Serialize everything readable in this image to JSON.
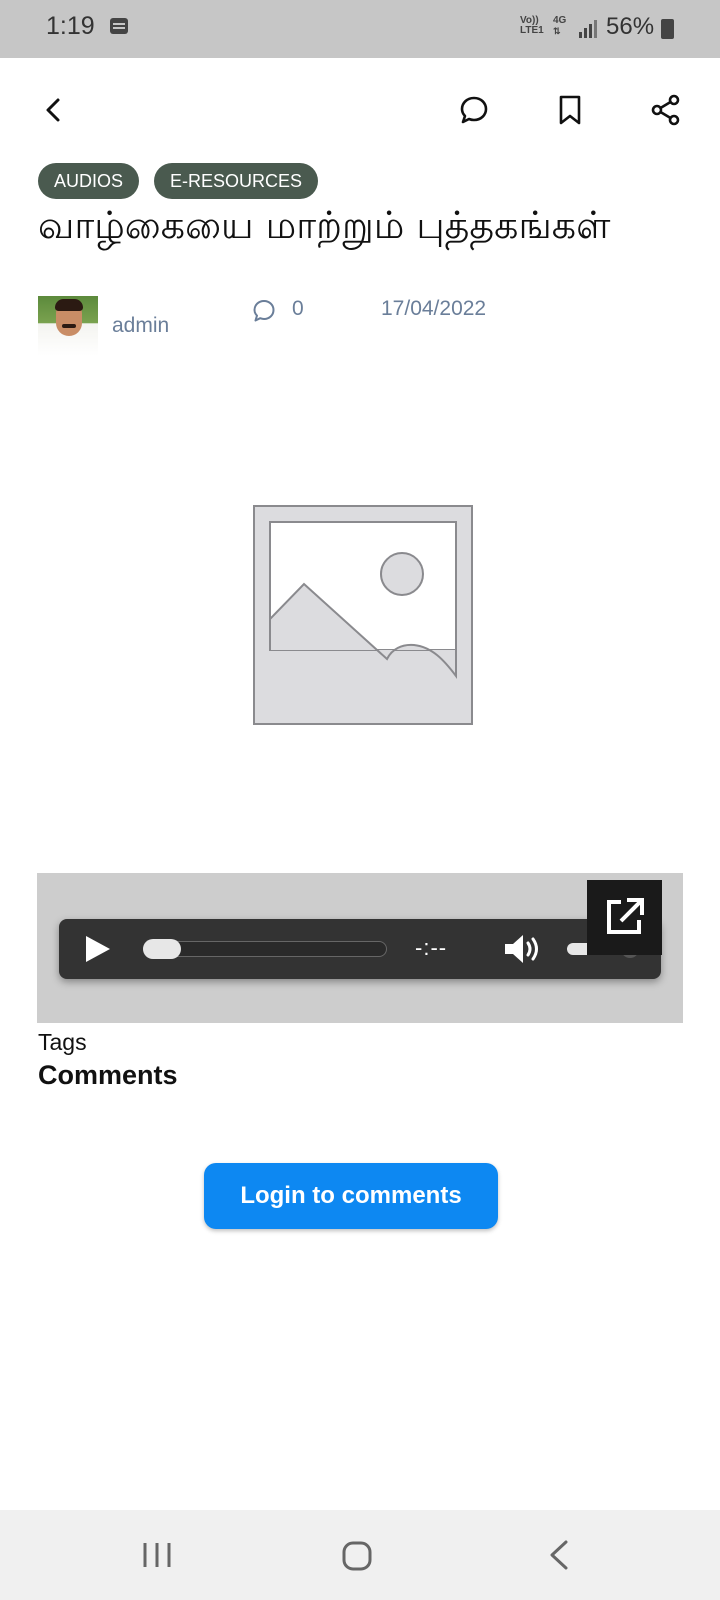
{
  "status_bar": {
    "time": "1:19",
    "network_top": "Vo))",
    "network_bottom": "LTE1",
    "mobile_data": "4G",
    "battery": "56%"
  },
  "post": {
    "categories": [
      "AUDIOS",
      "E-RESOURCES"
    ],
    "title": "வாழ்கையை மாற்றும் புத்தகங்கள்",
    "author": "admin",
    "comment_count": "0",
    "date": "17/04/2022"
  },
  "audio_player": {
    "time": "-:--",
    "progress": 0,
    "volume": 0.9
  },
  "sections": {
    "tags_label": "Tags",
    "comments_heading": "Comments",
    "login_button": "Login to comments"
  },
  "icons": {
    "back": "back-arrow-icon",
    "comment": "comment-bubble-icon",
    "bookmark": "bookmark-icon",
    "share": "share-icon"
  },
  "colors": {
    "chip_bg": "#4a5a4f",
    "accent": "#0d88f2",
    "meta_text": "#6a7e99",
    "player_bg": "#333333"
  }
}
